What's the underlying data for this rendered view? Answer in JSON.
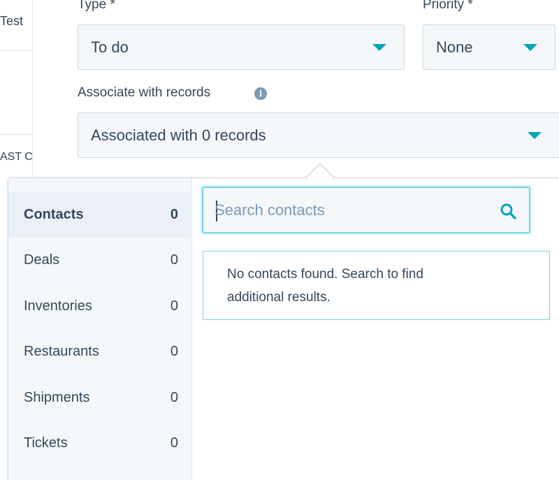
{
  "background_table": {
    "cell_top": "Test",
    "header_partial": "AST C"
  },
  "form": {
    "type_label": "Type *",
    "type_value": "To do",
    "priority_label": "Priority *",
    "priority_value": "None",
    "associate_label": "Associate with records",
    "associate_value": "Associated with 0 records"
  },
  "icons": {
    "info": "info-icon",
    "caret": "chevron-down-icon",
    "search": "search-icon"
  },
  "colors": {
    "accent": "#00a4bd",
    "text": "#33475b",
    "focus": "#7fd1de"
  },
  "objects": [
    {
      "label": "Contacts",
      "count": "0",
      "active": true
    },
    {
      "label": "Deals",
      "count": "0"
    },
    {
      "label": "Inventories",
      "count": "0"
    },
    {
      "label": "Restaurants",
      "count": "0"
    },
    {
      "label": "Shipments",
      "count": "0"
    },
    {
      "label": "Tickets",
      "count": "0"
    }
  ],
  "search": {
    "placeholder": "Search contacts",
    "value": ""
  },
  "empty_state": {
    "line1": "No contacts found. Search to find",
    "line2": "additional results."
  }
}
